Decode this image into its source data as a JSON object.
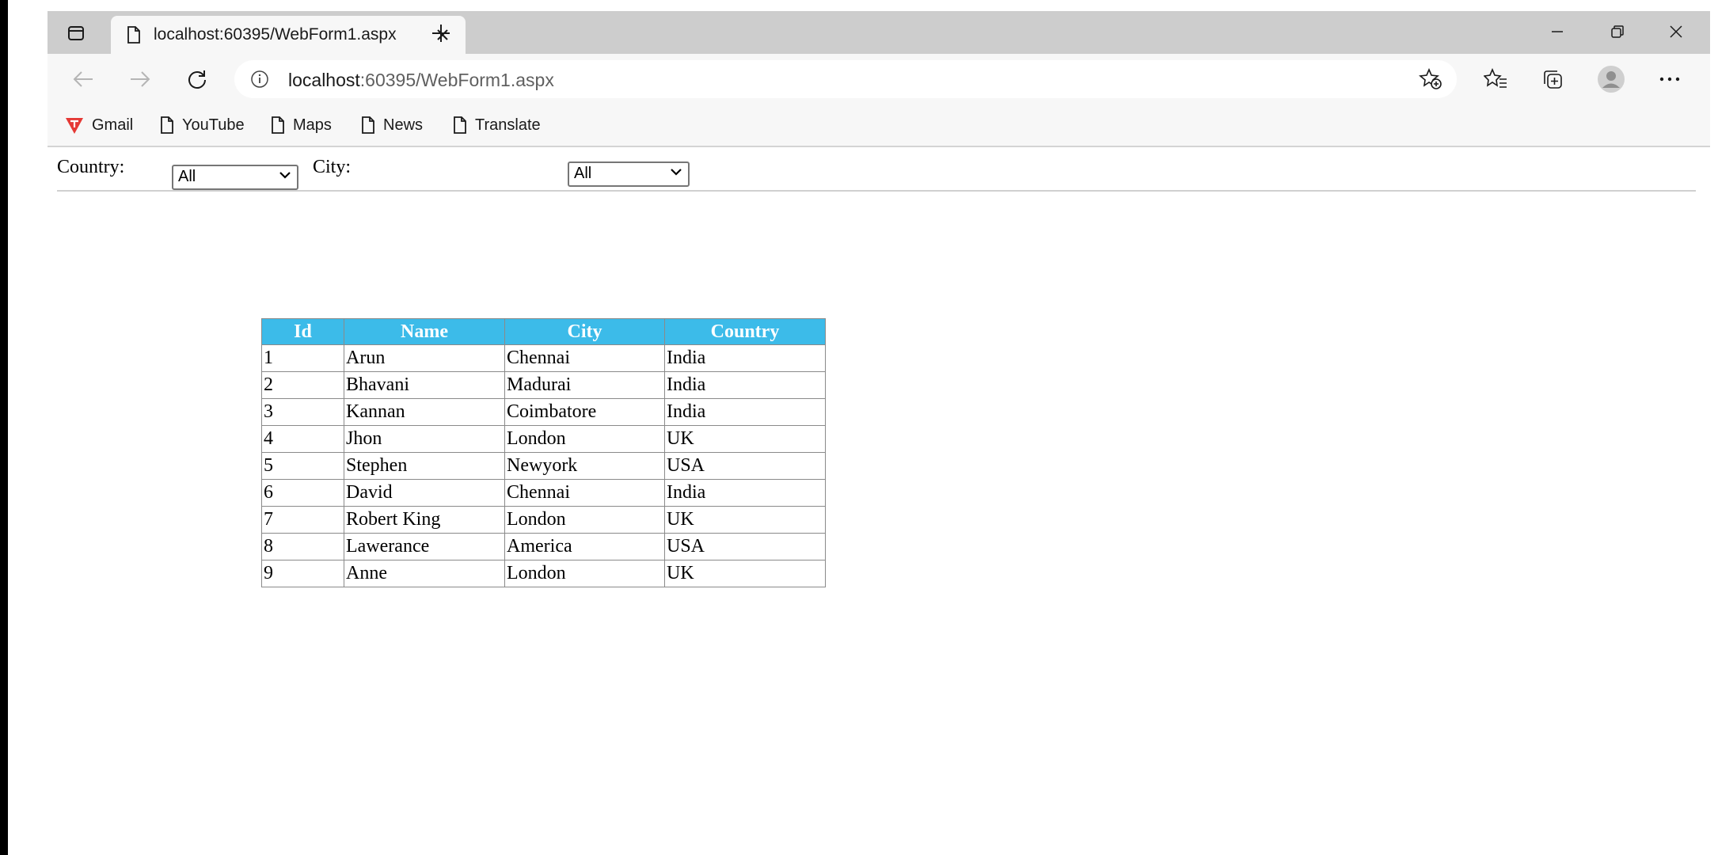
{
  "browser": {
    "tab_title": "localhost:60395/WebForm1.aspx",
    "url_host": "localhost",
    "url_rest": ":60395/WebForm1.aspx",
    "bookmarks": [
      "Gmail",
      "YouTube",
      "Maps",
      "News",
      "Translate"
    ]
  },
  "filters": {
    "country_label": "Country:",
    "country_value": "All",
    "city_label": "City:",
    "city_value": "All"
  },
  "table": {
    "headers": [
      "Id",
      "Name",
      "City",
      "Country"
    ],
    "rows": [
      [
        "1",
        "Arun",
        "Chennai",
        "India"
      ],
      [
        "2",
        "Bhavani",
        "Madurai",
        "India"
      ],
      [
        "3",
        "Kannan",
        "Coimbatore",
        "India"
      ],
      [
        "4",
        "Jhon",
        "London",
        "UK"
      ],
      [
        "5",
        "Stephen",
        "Newyork",
        "USA"
      ],
      [
        "6",
        "David",
        "Chennai",
        "India"
      ],
      [
        "7",
        "Robert King",
        "London",
        "UK"
      ],
      [
        "8",
        "Lawerance",
        "America",
        "USA"
      ],
      [
        "9",
        "Anne",
        "London",
        "UK"
      ]
    ]
  },
  "colors": {
    "header_bg": "#3cbbe9",
    "tabstrip_bg": "#cdcdcd",
    "toolbar_bg": "#f7f7f7",
    "gmail_icon": "#e53935"
  }
}
